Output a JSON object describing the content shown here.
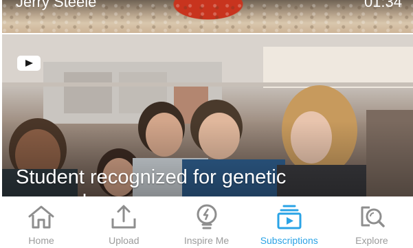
{
  "top_card": {
    "author": "Jerry Steele",
    "duration": "01:34"
  },
  "main_card": {
    "source_icon": "youtube-play-icon",
    "headline_line1": "Student recognized for genetic",
    "headline_line2": "research"
  },
  "tabbar": {
    "active": "subscriptions",
    "active_color": "#2aa3e6",
    "inactive_color": "#9b9b9b",
    "tabs": [
      {
        "id": "home",
        "label": "Home",
        "icon": "home-icon"
      },
      {
        "id": "upload",
        "label": "Upload",
        "icon": "upload-icon"
      },
      {
        "id": "inspire",
        "label": "Inspire Me",
        "icon": "lightbulb-bolt-icon"
      },
      {
        "id": "subscriptions",
        "label": "Subscriptions",
        "icon": "subscriptions-icon"
      },
      {
        "id": "explore",
        "label": "Explore",
        "icon": "search-explore-icon"
      }
    ]
  }
}
